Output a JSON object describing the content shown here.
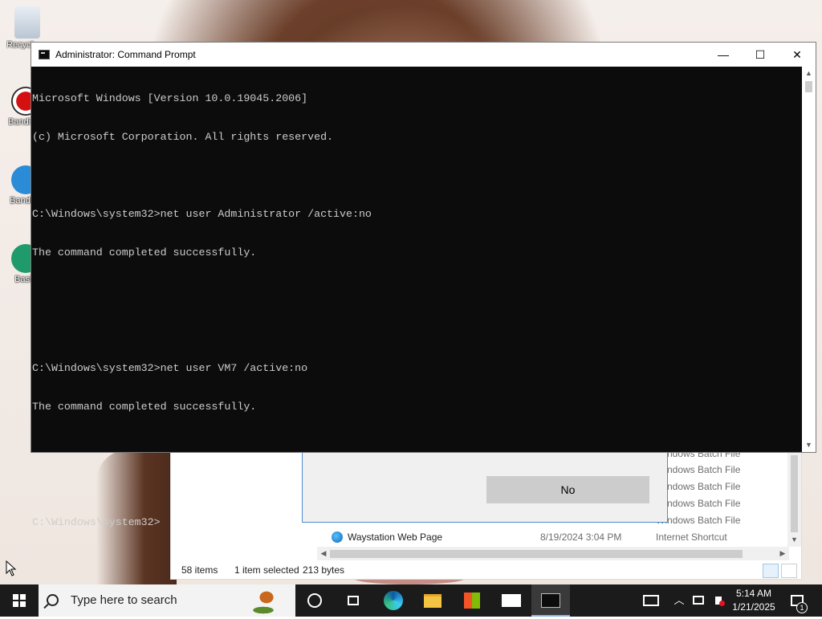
{
  "desktop": {
    "icons": [
      {
        "label": "Recycle Bin"
      },
      {
        "label": "Bandicam"
      },
      {
        "label": "Bandicut"
      },
      {
        "label": "Basic"
      }
    ]
  },
  "explorer": {
    "type_rows": [
      "Windows Batch File",
      "Windows Batch File",
      "Windows Batch File",
      "Windows Batch File",
      "Windows Batch File"
    ],
    "last_row": {
      "name": "Waystation Web Page",
      "date": "8/19/2024 3:04 PM",
      "type": "Internet Shortcut"
    },
    "status": {
      "items": "58 items",
      "selected": "1 item selected",
      "size": "213 bytes"
    }
  },
  "dialog": {
    "no_label": "No"
  },
  "cmd": {
    "title": "Administrator: Command Prompt",
    "lines": [
      "Microsoft Windows [Version 10.0.19045.2006]",
      "(c) Microsoft Corporation. All rights reserved.",
      "",
      "C:\\Windows\\system32>net user Administrator /active:no",
      "The command completed successfully.",
      "",
      "",
      "C:\\Windows\\system32>net user VM7 /active:no",
      "The command completed successfully.",
      "",
      "",
      "C:\\Windows\\system32>"
    ],
    "min_glyph": "—",
    "max_glyph": "☐",
    "close_glyph": "✕"
  },
  "taskbar": {
    "search_placeholder": "Type here to search",
    "clock_time": "5:14 AM",
    "clock_date": "1/21/2025",
    "notification_count": "1",
    "apps": [
      "cortana-icon",
      "task-view-icon",
      "edge-icon",
      "file-explorer-icon",
      "store-icon",
      "mail-icon",
      "cmd-icon"
    ]
  },
  "colors": {
    "console_bg": "#0c0c0c",
    "console_fg": "#cccccc",
    "taskbar": "#1b1b1b",
    "accent": "#4d8cd1"
  }
}
